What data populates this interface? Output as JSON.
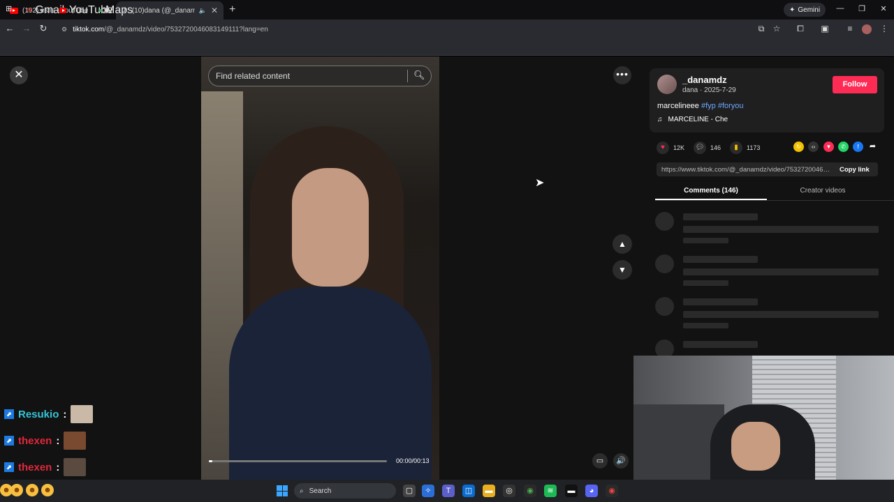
{
  "tabs": [
    {
      "title": "(192) eslis - YouTube",
      "close": "✕"
    },
    {
      "title": "(10)dana (@_danamdz) | Ti",
      "close": "✕"
    }
  ],
  "new_tab": "+",
  "gemini": {
    "label": "Gemini"
  },
  "window_controls": {
    "minimize": "—",
    "restore": "❐",
    "close": "✕"
  },
  "address": {
    "host": "tiktok.com",
    "path": "/@_danamdz/video/7532720046083149111?lang=en"
  },
  "bookmarks": [
    {
      "label": "Gmail",
      "icon": "gmail-icon"
    },
    {
      "label": "YouTube",
      "icon": "youtube-icon"
    },
    {
      "label": "Maps",
      "icon": "maps-icon"
    }
  ],
  "viewer": {
    "close": "✕",
    "search_placeholder": "Find related content",
    "more": "•••",
    "time": "00:00/00:13",
    "progress": 0.02
  },
  "author": {
    "username": "_danamdz",
    "subline": "dana · 2025-7-29",
    "follow": "Follow",
    "caption": "marcelineee",
    "hashtags": [
      "#fyp",
      "#foryou"
    ],
    "music": "MARCELINE - Che"
  },
  "stats": {
    "likes": "12K",
    "comments": "146",
    "saves": "1173"
  },
  "share_link": {
    "url": "https://www.tiktok.com/@_danamdz/video/7532720046083149111",
    "copy": "Copy link"
  },
  "panel_tabs": {
    "comments": "Comments (146)",
    "creator": "Creator videos"
  },
  "chat": [
    {
      "user": "Resukio",
      "color": "#35c4d8"
    },
    {
      "user": "thexen",
      "color": "#e0283c"
    },
    {
      "user": "thexen",
      "color": "#e0283c"
    }
  ],
  "taskbar": {
    "search": "Search"
  }
}
